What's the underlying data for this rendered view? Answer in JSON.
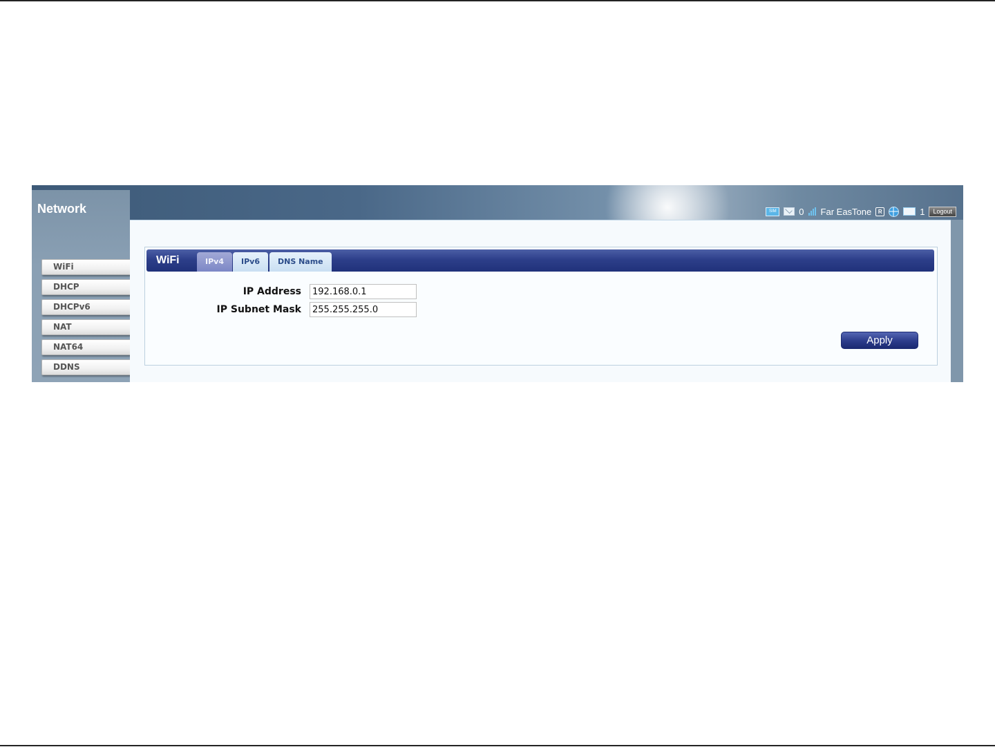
{
  "section": {
    "title": "Network"
  },
  "status_bar": {
    "sim_label": "SIM",
    "messages_count": "0",
    "carrier": "Far EasTone",
    "roaming_label": "R",
    "clients_count": "1",
    "logout_label": "Logout"
  },
  "menu": {
    "items": [
      {
        "label": "WiFi"
      },
      {
        "label": "DHCP"
      },
      {
        "label": "DHCPv6"
      },
      {
        "label": "NAT"
      },
      {
        "label": "NAT64"
      },
      {
        "label": "DDNS"
      }
    ]
  },
  "panel": {
    "title": "WiFi",
    "tabs": [
      {
        "label": "IPv4",
        "active": true
      },
      {
        "label": "IPv6",
        "active": false
      },
      {
        "label": "DNS Name",
        "active": false
      }
    ]
  },
  "form": {
    "ip_address": {
      "label": "IP Address",
      "value": "192.168.0.1"
    },
    "subnet_mask": {
      "label": "IP Subnet Mask",
      "value": "255.255.255.0"
    },
    "apply_label": "Apply"
  },
  "colors": {
    "tabbar": "#2d3f8a",
    "apply_button": "#2b3b8a",
    "header": "#4a6888"
  }
}
